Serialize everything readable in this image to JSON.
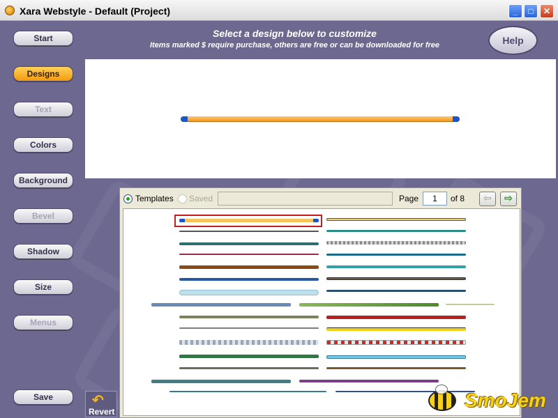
{
  "window": {
    "title": "Xara Webstyle - Default (Project)",
    "minimize_glyph": "_",
    "maximize_glyph": "□",
    "close_glyph": "✕"
  },
  "header": {
    "title": "Select a design below to customize",
    "subtitle": "Items marked $ require purchase, others are free or can be downloaded for free",
    "help_label": "Help"
  },
  "nav": {
    "items": [
      {
        "label": "Start",
        "state": "normal"
      },
      {
        "label": "Designs",
        "state": "active"
      },
      {
        "label": "Text",
        "state": "disabled"
      },
      {
        "label": "Colors",
        "state": "normal"
      },
      {
        "label": "Background",
        "state": "normal"
      },
      {
        "label": "Bevel",
        "state": "disabled"
      },
      {
        "label": "Shadow",
        "state": "normal"
      },
      {
        "label": "Size",
        "state": "normal"
      },
      {
        "label": "Menus",
        "state": "disabled"
      }
    ],
    "save_label": "Save",
    "revert_label": "Revert",
    "revert_icon": "↶"
  },
  "designs_panel": {
    "templates_label": "Templates",
    "saved_label": "Saved",
    "source_selected": "Templates",
    "name_value": "",
    "page_label": "Page",
    "page_value": "1",
    "of_label": "of 8",
    "prev_glyph": "⇦",
    "next_glyph": "⇨"
  },
  "colors": {
    "accent_orange": "#f29a10",
    "selection_red": "#c61c1c",
    "background_purple": "#6d688f",
    "preview_cap_blue": "#1c55c8"
  },
  "watermark": {
    "text": "SmoJem"
  }
}
